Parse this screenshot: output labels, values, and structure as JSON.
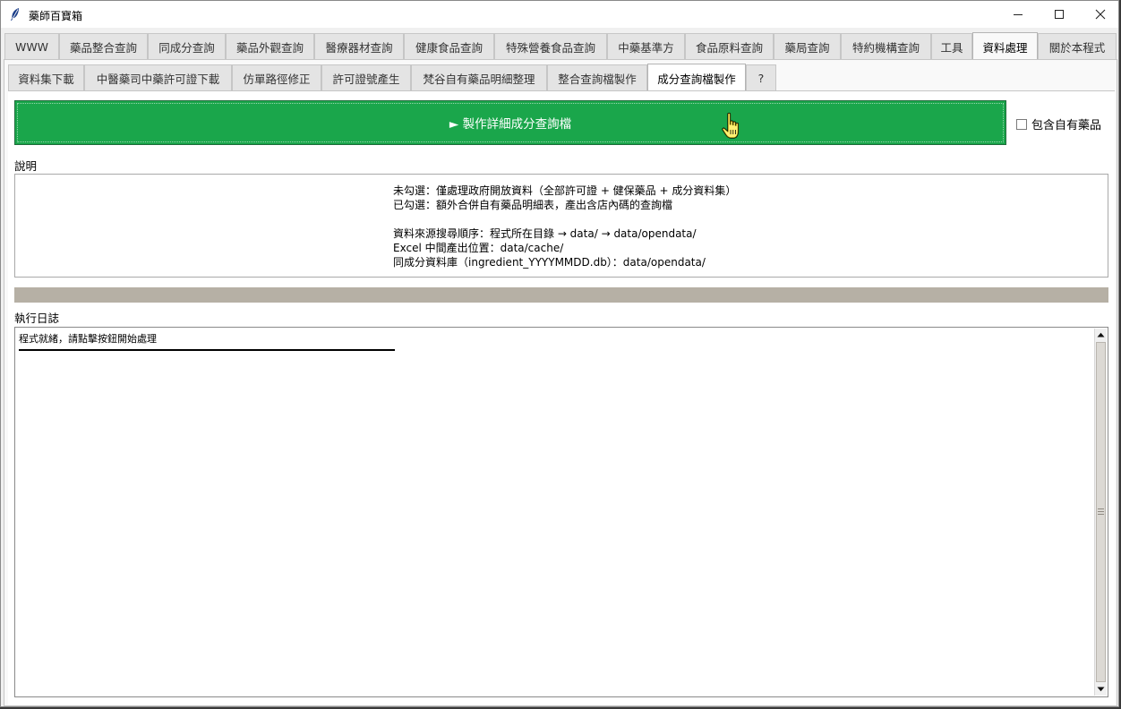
{
  "window": {
    "title": "藥師百寶箱"
  },
  "main_tabs": [
    {
      "label": "WWW",
      "active": false
    },
    {
      "label": "藥品整合查詢",
      "active": false
    },
    {
      "label": "同成分查詢",
      "active": false
    },
    {
      "label": "藥品外觀查詢",
      "active": false
    },
    {
      "label": "醫療器材查詢",
      "active": false
    },
    {
      "label": "健康食品查詢",
      "active": false
    },
    {
      "label": "特殊營養食品查詢",
      "active": false
    },
    {
      "label": "中藥基準方",
      "active": false
    },
    {
      "label": "食品原料查詢",
      "active": false
    },
    {
      "label": "藥局查詢",
      "active": false
    },
    {
      "label": "特約機構查詢",
      "active": false
    },
    {
      "label": "工具",
      "active": false
    },
    {
      "label": "資料處理",
      "active": true
    },
    {
      "label": "關於本程式",
      "active": false
    }
  ],
  "sub_tabs": [
    {
      "label": "資料集下載",
      "active": false
    },
    {
      "label": "中醫藥司中藥許可證下載",
      "active": false
    },
    {
      "label": "仿單路徑修正",
      "active": false
    },
    {
      "label": "許可證號產生",
      "active": false
    },
    {
      "label": "梵谷自有藥品明細整理",
      "active": false
    },
    {
      "label": "整合查詢檔製作",
      "active": false
    },
    {
      "label": "成分查詢檔製作",
      "active": true
    },
    {
      "label": "?",
      "active": false
    }
  ],
  "make_button": {
    "label": "► 製作詳細成分查詢檔",
    "color": "#1aa64b"
  },
  "include_own": {
    "label": "包含自有藥品",
    "checked": false
  },
  "description": {
    "label": "說明",
    "lines": [
      "未勾選：僅處理政府開放資料（全部許可證 + 健保藥品 + 成分資料集）",
      "已勾選：額外合併自有藥品明細表，產出含店內碼的查詢檔",
      "",
      "資料來源搜尋順序：程式所在目錄 → data/ → data/opendata/",
      "Excel 中間產出位置：data/cache/",
      "同成分資料庫（ingredient_YYYYMMDD.db）：data/opendata/"
    ]
  },
  "progress": {
    "value": 0
  },
  "log": {
    "label": "執行日誌",
    "text": "程式就緒，請點擊按鈕開始處理"
  }
}
